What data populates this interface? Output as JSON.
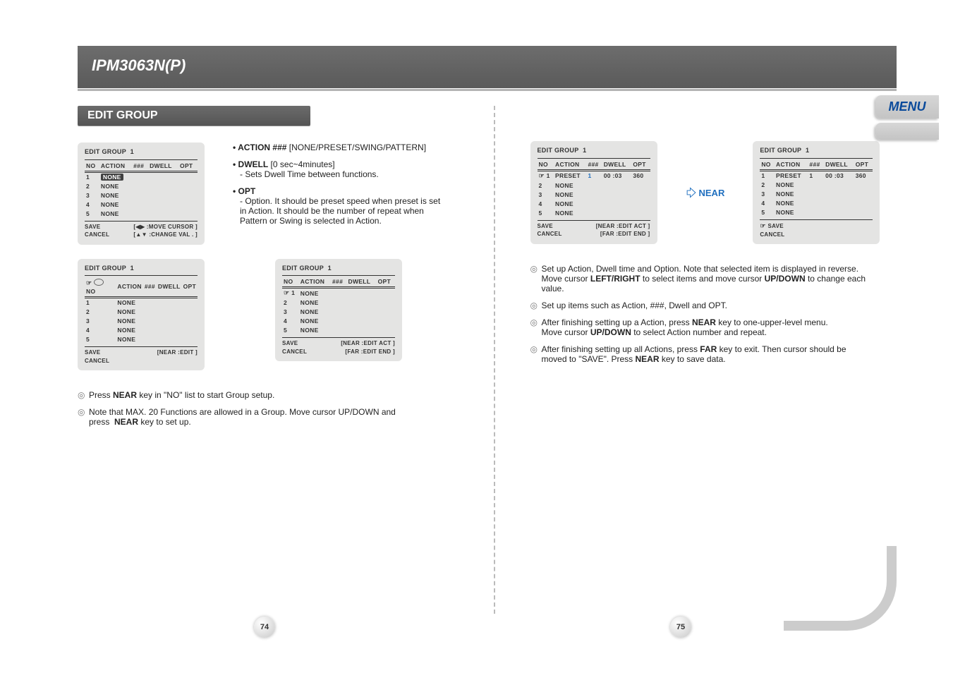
{
  "model": "IPM3063N(P)",
  "menu_tab": "MENU",
  "section_title": "EDIT GROUP",
  "page_left": "74",
  "page_right": "75",
  "near_label": "NEAR",
  "osd_common": {
    "title_prefix": "EDIT GROUP",
    "group_no": "1",
    "headers": {
      "no": "NO",
      "action": "ACTION",
      "hash": "###",
      "dwell": "DWELL",
      "opt": "OPT"
    },
    "save": "SAVE",
    "cancel": "CANCEL"
  },
  "osd_A": {
    "rows": [
      {
        "no": "1",
        "action": "NONE",
        "rev": true
      },
      {
        "no": "2",
        "action": "NONE"
      },
      {
        "no": "3",
        "action": "NONE"
      },
      {
        "no": "4",
        "action": "NONE"
      },
      {
        "no": "5",
        "action": "NONE"
      }
    ],
    "hint1": "[◀▶ :MOVE CURSOR  ]",
    "hint2": "[▲▼ :CHANGE VAL .  ]"
  },
  "osd_B": {
    "cursor_on": "header",
    "rows": [
      {
        "no": "1",
        "action": "NONE"
      },
      {
        "no": "2",
        "action": "NONE"
      },
      {
        "no": "3",
        "action": "NONE"
      },
      {
        "no": "4",
        "action": "NONE"
      },
      {
        "no": "5",
        "action": "NONE"
      }
    ],
    "hint": "[NEAR :EDIT ]"
  },
  "osd_C": {
    "rows": [
      {
        "no": "1",
        "action": "NONE",
        "cursor": true
      },
      {
        "no": "2",
        "action": "NONE"
      },
      {
        "no": "3",
        "action": "NONE"
      },
      {
        "no": "4",
        "action": "NONE"
      },
      {
        "no": "5",
        "action": "NONE"
      }
    ],
    "hint1": "[NEAR :EDIT ACT  ]",
    "hint2": "[FAR   :EDIT END  ]"
  },
  "osd_D": {
    "rows": [
      {
        "no": "1",
        "action": "PRESET",
        "hash": "1",
        "dwell": "00 :03",
        "opt": "360",
        "cursor": true,
        "blue": true
      },
      {
        "no": "2",
        "action": "NONE"
      },
      {
        "no": "3",
        "action": "NONE"
      },
      {
        "no": "4",
        "action": "NONE"
      },
      {
        "no": "5",
        "action": "NONE"
      }
    ],
    "hint1": "[NEAR :EDIT ACT  ]",
    "hint2": "[FAR   :EDIT END  ]"
  },
  "osd_E": {
    "rows": [
      {
        "no": "1",
        "action": "PRESET",
        "hash": "1",
        "dwell": "00 :03",
        "opt": "360"
      },
      {
        "no": "2",
        "action": "NONE"
      },
      {
        "no": "3",
        "action": "NONE"
      },
      {
        "no": "4",
        "action": "NONE"
      },
      {
        "no": "5",
        "action": "NONE"
      }
    ],
    "save_cursor": true
  },
  "bullets": {
    "action_label": "• ACTION ###",
    "action_range": "[NONE/PRESET/SWING/PATTERN]",
    "dwell_label": "• DWELL",
    "dwell_range": "[0 sec~4minutes]",
    "dwell_desc": "- Sets Dwell Time between functions.",
    "opt_label": "• OPT",
    "opt_desc1": "- Option. It should be preset speed when preset is set",
    "opt_desc2": "in Action. It should be the number of repeat when",
    "opt_desc3": "Pattern or Swing is selected in Action."
  },
  "left_steps": {
    "s1": "Press NEAR key in \"NO\" list to start Group setup.",
    "s2a": "Note that MAX. 20 Functions are allowed in a Group. Move cursor UP/DOWN and",
    "s2b": "press  NEAR key to set up."
  },
  "right_steps": {
    "s1a": "Set up Action, Dwell time and Option. Note that selected item is displayed in reverse.",
    "s1b": "Move cursor LEFT/RIGHT to select items and move cursor UP/DOWN to change each",
    "s1c": "value.",
    "s2": "Set up items such as Action, ###, Dwell and OPT.",
    "s3a": "After finishing setting up a Action, press NEAR key to one-upper-level menu.",
    "s3b": "Move cursor UP/DOWN to select Action number and repeat.",
    "s4a": "After finishing setting up all Actions, press FAR key to exit. Then cursor should be",
    "s4b": "moved to \"SAVE\". Press NEAR key to save data."
  }
}
